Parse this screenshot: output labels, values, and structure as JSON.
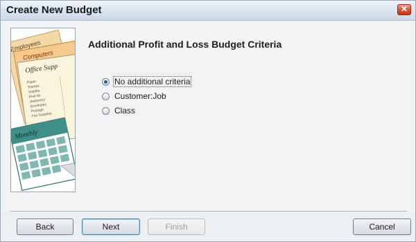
{
  "window": {
    "title": "Create New Budget",
    "close_icon": "close-icon"
  },
  "illustration": {
    "labels": [
      "Employees",
      "Computers",
      "Office Supp",
      "Monthly"
    ],
    "ledger_lines": [
      "Paper",
      "Stamps",
      "Staples",
      "Post-its",
      "Stationery",
      "Envelopes",
      "Postage",
      "Fax Supplies"
    ]
  },
  "main": {
    "heading": "Additional Profit and Loss Budget Criteria",
    "options": [
      {
        "label": "No additional criteria",
        "checked": true
      },
      {
        "label": "Customer:Job",
        "checked": false
      },
      {
        "label": "Class",
        "checked": false
      }
    ]
  },
  "buttons": {
    "back": "Back",
    "next": "Next",
    "finish": "Finish",
    "cancel": "Cancel"
  },
  "colors": {
    "accent": "#1b5fb3",
    "close": "#c2381f"
  }
}
